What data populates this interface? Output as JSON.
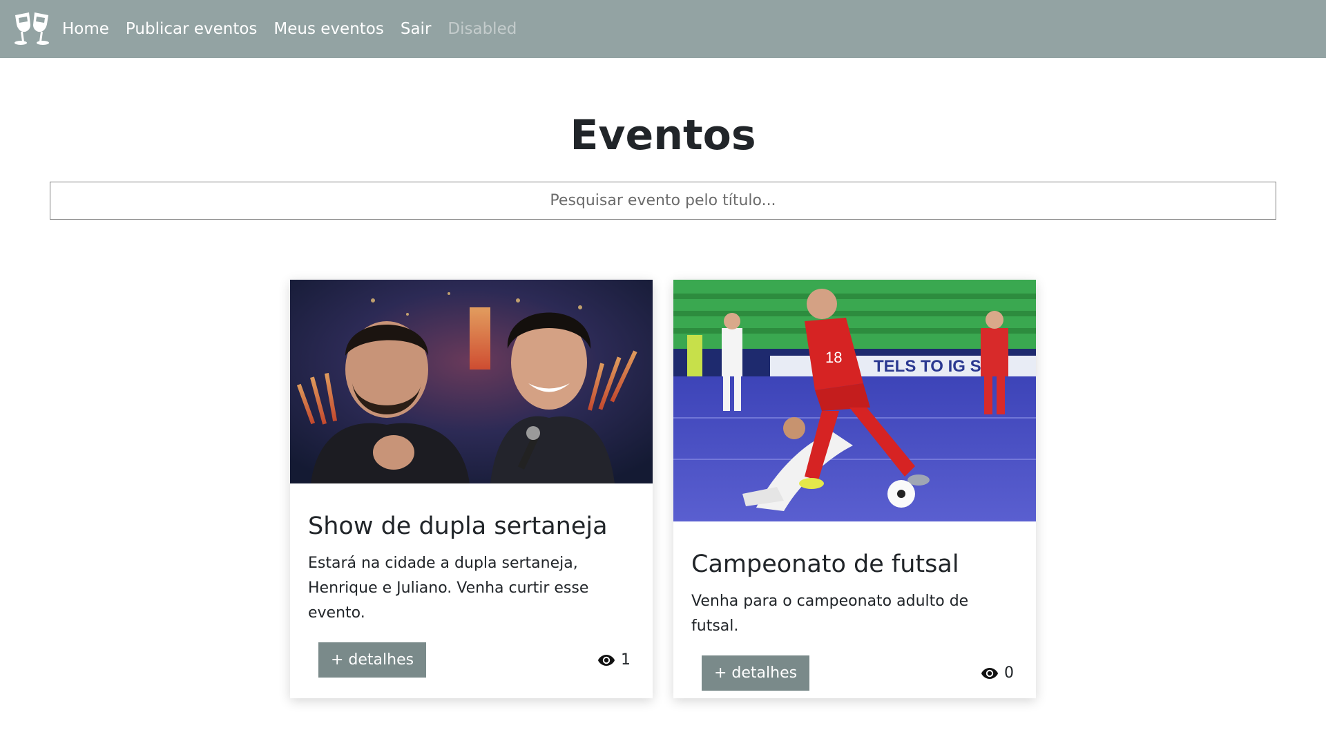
{
  "nav": {
    "brand_icon": "toast-glasses-icon",
    "items": [
      {
        "label": "Home"
      },
      {
        "label": "Publicar eventos"
      },
      {
        "label": "Meus eventos"
      },
      {
        "label": "Sair"
      },
      {
        "label": "Disabled"
      }
    ]
  },
  "main": {
    "title": "Eventos",
    "search": {
      "placeholder": "Pesquisar evento pelo título...",
      "value": ""
    }
  },
  "events": [
    {
      "title": "Show de dupla sertaneja",
      "description": "Estará na cidade a dupla sertaneja, Henrique e Juliano. Venha curtir esse evento.",
      "button_label": "+ detalhes",
      "views": "1",
      "views_icon": "eye-icon"
    },
    {
      "title": "Campeonato de futsal",
      "description": "Venha para o campeonato adulto de futsal.",
      "button_label": "+ detalhes",
      "views": "0",
      "views_icon": "eye-icon"
    }
  ],
  "colors": {
    "navbar": "#93a3a3",
    "button": "#7a8a8a",
    "nav_disabled": "#c4cccc"
  }
}
